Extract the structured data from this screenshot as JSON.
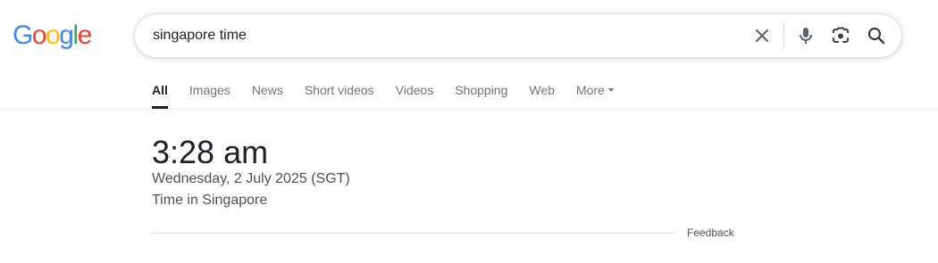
{
  "logo": {
    "letters": [
      {
        "char": "G",
        "color": "#4285F4"
      },
      {
        "char": "o",
        "color": "#EA4335"
      },
      {
        "char": "o",
        "color": "#FBBC05"
      },
      {
        "char": "g",
        "color": "#4285F4"
      },
      {
        "char": "l",
        "color": "#34A853"
      },
      {
        "char": "e",
        "color": "#EA4335"
      }
    ]
  },
  "search": {
    "value": "singapore time",
    "icons": {
      "clear": "close-icon",
      "voice": "microphone-icon",
      "lens": "camera-lens-icon",
      "submit": "search-icon"
    }
  },
  "tabs": [
    {
      "label": "All",
      "active": true
    },
    {
      "label": "Images",
      "active": false
    },
    {
      "label": "News",
      "active": false
    },
    {
      "label": "Short videos",
      "active": false
    },
    {
      "label": "Videos",
      "active": false
    },
    {
      "label": "Shopping",
      "active": false
    },
    {
      "label": "Web",
      "active": false
    },
    {
      "label": "More",
      "active": false,
      "has_dropdown": true
    }
  ],
  "result": {
    "time": "3:28 am",
    "date": "Wednesday, 2 July 2025 (SGT)",
    "location": "Time in Singapore",
    "feedback": "Feedback"
  },
  "colors": {
    "text_primary": "#202124",
    "text_secondary": "#4d5156",
    "tab_inactive": "#70757a",
    "icon_gray": "#5f6368"
  }
}
